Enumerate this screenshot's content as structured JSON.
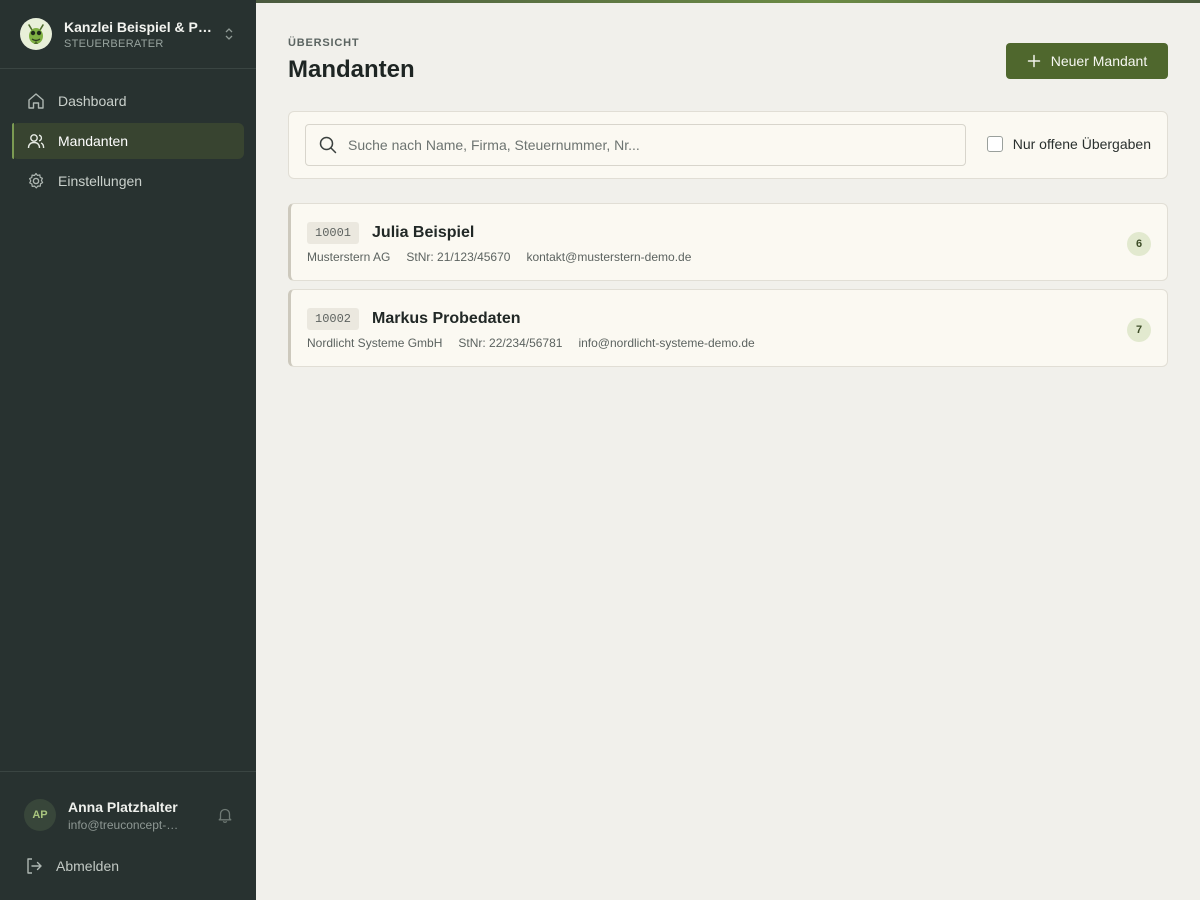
{
  "brand": {
    "name": "Kanzlei Beispiel & Partner",
    "subtitle": "STEUERBERATER"
  },
  "nav": {
    "items": [
      {
        "label": "Dashboard",
        "icon": "home-icon",
        "active": false
      },
      {
        "label": "Mandanten",
        "icon": "users-icon",
        "active": true
      },
      {
        "label": "Einstellungen",
        "icon": "gear-icon",
        "active": false
      }
    ]
  },
  "user": {
    "initials": "AP",
    "name": "Anna Platzhalter",
    "email": "info@treuconcept-…",
    "logout_label": "Abmelden"
  },
  "header": {
    "overline": "ÜBERSICHT",
    "title": "Mandanten",
    "new_button_label": "Neuer Mandant"
  },
  "search": {
    "placeholder": "Suche nach Name, Firma, Steuernummer, Nr...",
    "value": "",
    "filter_label": "Nur offene Übergaben",
    "filter_checked": false
  },
  "clients": [
    {
      "number": "10001",
      "name": "Julia Beispiel",
      "company": "Musterstern AG",
      "tax_no": "StNr: 21/123/45670",
      "email": "kontakt@musterstern-demo.de",
      "count": "6"
    },
    {
      "number": "10002",
      "name": "Markus Probedaten",
      "company": "Nordlicht Systeme GmbH",
      "tax_no": "StNr: 22/234/56781",
      "email": "info@nordlicht-systeme-demo.de",
      "count": "7"
    }
  ],
  "colors": {
    "sidebar_bg": "#283230",
    "accent": "#4f672d",
    "page_bg": "#f1f0eb",
    "card_bg": "#fbf9f2"
  }
}
